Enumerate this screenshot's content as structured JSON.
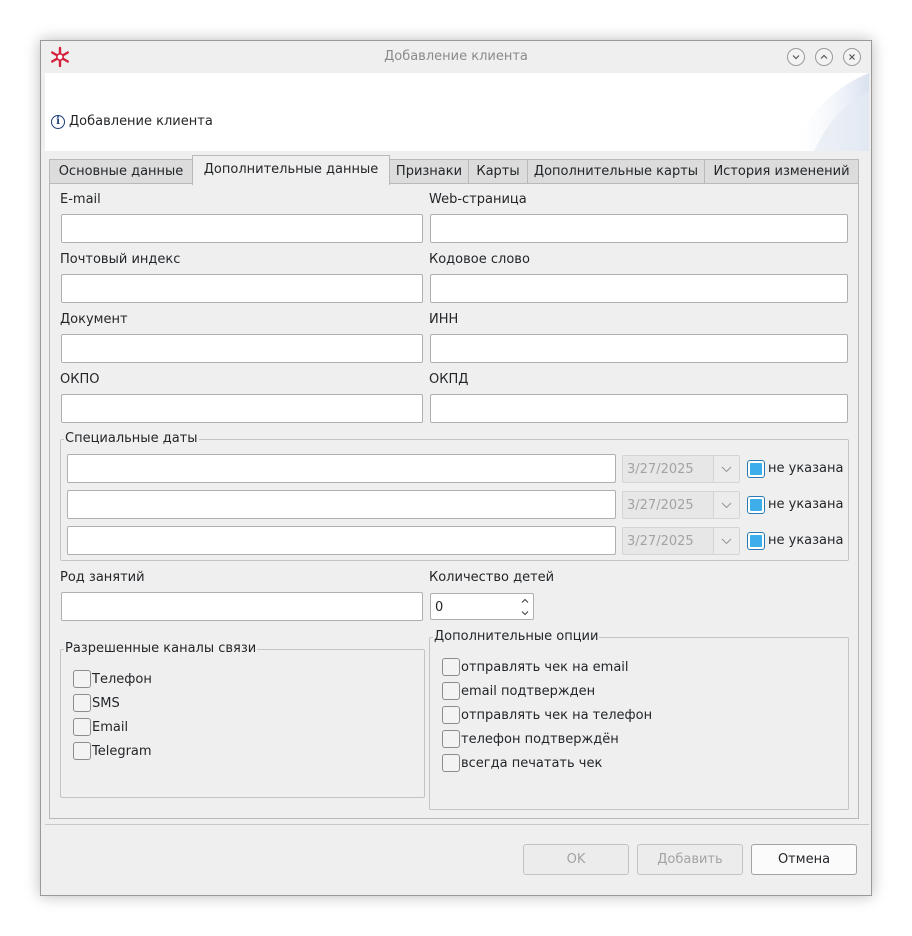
{
  "window": {
    "title": "Добавление клиента"
  },
  "header": {
    "title": "Добавление клиента"
  },
  "tabs": [
    {
      "label": "Основные данные"
    },
    {
      "label": "Дополнительные данные"
    },
    {
      "label": "Признаки"
    },
    {
      "label": "Карты"
    },
    {
      "label": "Дополнительные карты"
    },
    {
      "label": "История изменений"
    }
  ],
  "active_tab": "Дополнительные данные",
  "form": {
    "email_label": "E-mail",
    "email_value": "",
    "web_label": "Web-страница",
    "web_value": "",
    "postcode_label": "Почтовый индекс",
    "postcode_value": "",
    "codeword_label": "Кодовое слово",
    "codeword_value": "",
    "document_label": "Документ",
    "document_value": "",
    "inn_label": "ИНН",
    "inn_value": "",
    "okpo_label": "ОКПО",
    "okpo_value": "",
    "okpd_label": "ОКПД",
    "okpd_value": "",
    "occupation_label": "Род занятий",
    "occupation_value": "",
    "children_label": "Количество детей",
    "children_value": "0"
  },
  "special_dates": {
    "title": "Специальные даты",
    "rows": [
      {
        "name": "",
        "date": "3/27/2025",
        "not_set_label": "не указана",
        "not_set_checked": true
      },
      {
        "name": "",
        "date": "3/27/2025",
        "not_set_label": "не указана",
        "not_set_checked": true
      },
      {
        "name": "",
        "date": "3/27/2025",
        "not_set_label": "не указана",
        "not_set_checked": true
      }
    ]
  },
  "channels": {
    "title": "Разрешенные каналы связи",
    "items": [
      {
        "label": "Телефон",
        "checked": false
      },
      {
        "label": "SMS",
        "checked": false
      },
      {
        "label": "Email",
        "checked": false
      },
      {
        "label": "Telegram",
        "checked": false
      }
    ]
  },
  "options": {
    "title": "Дополнительные опции",
    "items": [
      {
        "label": "отправлять чек на email",
        "checked": false
      },
      {
        "label": "email подтвержден",
        "checked": false
      },
      {
        "label": "отправлять чек на телефон",
        "checked": false
      },
      {
        "label": "телефон подтверждён",
        "checked": false
      },
      {
        "label": "всегда печатать чек",
        "checked": false
      }
    ]
  },
  "buttons": {
    "ok": "OK",
    "add": "Добавить",
    "cancel": "Отмена"
  },
  "colors": {
    "accent": "#3daee9",
    "window_bg": "#efefef",
    "logo": "#d4213d",
    "info": "#1d3f7a"
  }
}
